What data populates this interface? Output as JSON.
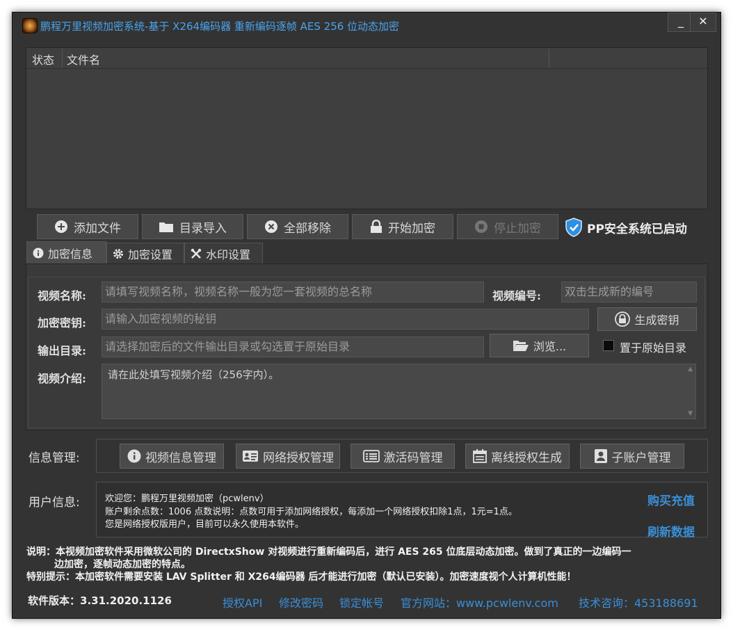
{
  "window": {
    "title": "鹏程万里视频加密系统-基于 X264编码器 重新编码逐帧 AES 256 位动态加密",
    "minimize_label": "_",
    "close_label": "✕"
  },
  "filelist": {
    "columns": [
      "状态",
      "文件名"
    ]
  },
  "toolbar": {
    "add_file": "添加文件",
    "import_dir": "目录导入",
    "remove_all": "全部移除",
    "start_encrypt": "开始加密",
    "stop_encrypt": "停止加密",
    "pp_status": "PP安全系统已启动"
  },
  "tabs": [
    {
      "label": "加密信息",
      "icon": "info-icon"
    },
    {
      "label": "加密设置",
      "icon": "gear-icon"
    },
    {
      "label": "水印设置",
      "icon": "tools-icon"
    }
  ],
  "form": {
    "video_name_label": "视频名称:",
    "video_name_placeholder": "请填写视频名称，视频名称一般为您一套视频的总名称",
    "video_id_label": "视频编号:",
    "video_id_placeholder": "双击生成新的编号",
    "key_label": "加密密钥:",
    "key_placeholder": "请输入加密视频的秘钥",
    "gen_key_button": "生成密钥",
    "output_label": "输出目录:",
    "output_placeholder": "请选择加密后的文件输出目录或勾选置于原始目录",
    "browse_button": "浏览...",
    "place_original_label": "置于原始目录",
    "intro_label": "视频介绍:",
    "intro_text": "请在此处填写视频介绍（256字内）。"
  },
  "info_mgmt": {
    "label": "信息管理:",
    "buttons": [
      "视频信息管理",
      "网络授权管理",
      "激活码管理",
      "离线授权生成",
      "子账户管理"
    ]
  },
  "user_info": {
    "label": "用户信息:",
    "line1": "欢迎您：鹏程万里视频加密（pcwlenv）",
    "line2": "账户剩余点数：1006   点数说明：点数可用于添加网络授权，每添加一个网络授权扣除1点，1元=1点。",
    "line3": "您是网络授权版用户，目前可以永久使用本软件。",
    "buy_link": "购买充值",
    "refresh_link": "刷新数据"
  },
  "notes": {
    "line1": "说明：本视频加密软件采用微软公司的 DirectxShow 对视频进行重新编码后，进行 AES 265 位底层动态加密。做到了真正的一边编码一",
    "line2": "边加密，逐帧动态加密的特点。",
    "line3": "特别提示：本加密软件需要安装 LAV Splitter 和 X264编码器 后才能进行加密（默认已安装）。加密速度视个人计算机性能！"
  },
  "footer": {
    "version": "软件版本：3.31.2020.1126",
    "links": [
      "授权API",
      "修改密码",
      "锁定帐号",
      "官方网站：www.pcwlenv.com",
      "技术咨询：453188691"
    ]
  },
  "colors": {
    "window_bg": "#333333",
    "title_text": "#4aa3ec",
    "link": "#3a8fd8",
    "button_bg": "#4a4a4a",
    "shield": "#2f8fe0"
  }
}
